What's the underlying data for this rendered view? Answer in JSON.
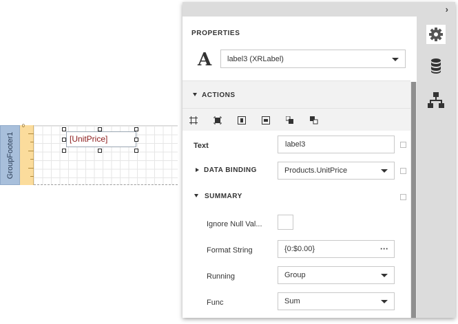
{
  "designer": {
    "band_name": "GroupFooter1",
    "ruler_zero": "0",
    "label_text": "[UnitPrice]"
  },
  "panel": {
    "collapse_icon": "chevron-right-icon",
    "properties_title": "PROPERTIES",
    "element_icon": "text-A-icon",
    "element_icon_text": "A",
    "element_selector": "label3 (XRLabel)",
    "tabs": [
      "gear-icon",
      "database-icon",
      "hierarchy-icon"
    ],
    "actions_header": "ACTIONS",
    "action_icons": [
      "fit-bounds-icon",
      "fit-text-icon",
      "center-horizontal-icon",
      "center-vertical-icon",
      "bring-to-front-icon",
      "send-to-back-icon"
    ],
    "properties": {
      "text": {
        "label": "Text",
        "value": "label3"
      },
      "data_binding": {
        "label": "DATA BINDING",
        "value": "Products.UnitPrice"
      },
      "summary": {
        "label": "SUMMARY"
      },
      "ignore_null": {
        "label": "Ignore Null Val..."
      },
      "format_string": {
        "label": "Format String",
        "value": "{0:$0.00}",
        "button": "···"
      },
      "running": {
        "label": "Running",
        "value": "Group"
      },
      "func": {
        "label": "Func",
        "value": "Sum"
      }
    }
  }
}
